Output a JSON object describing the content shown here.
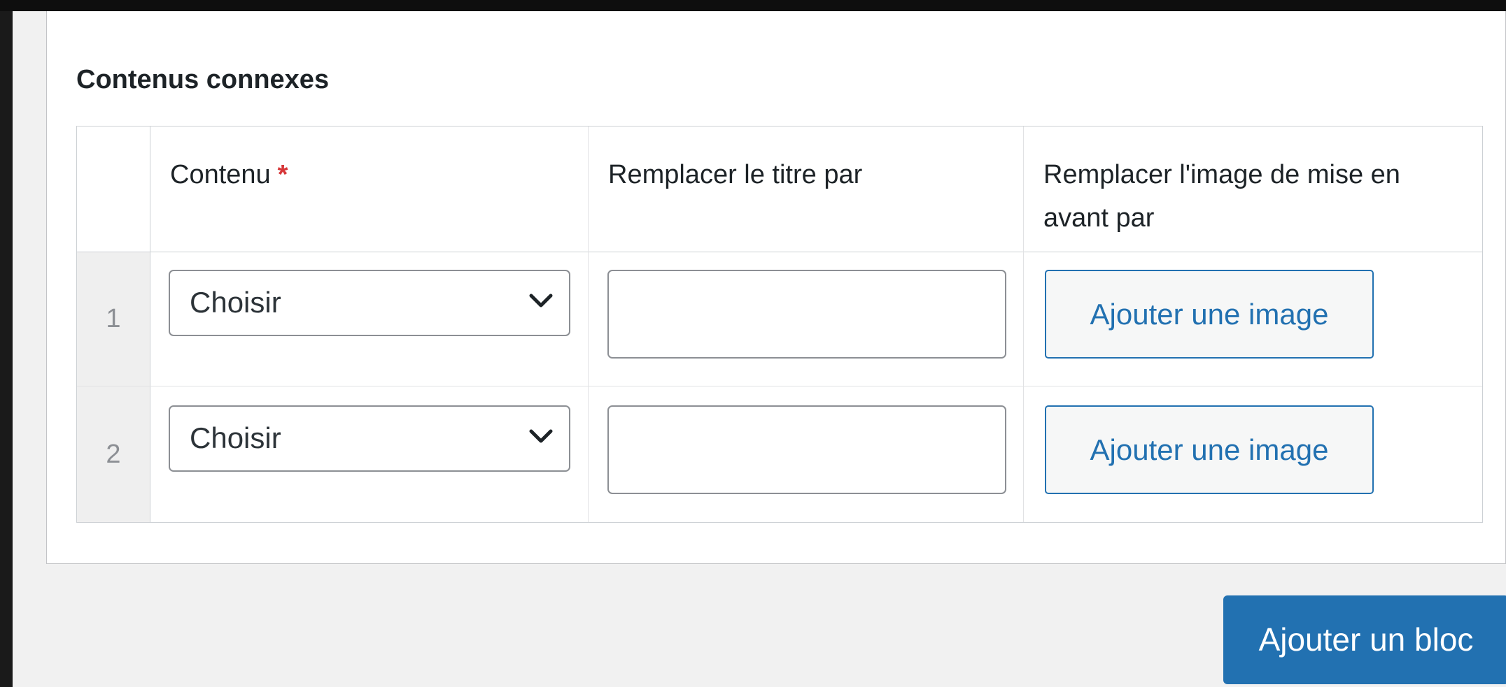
{
  "section": {
    "title": "Contenus connexes"
  },
  "table": {
    "headers": {
      "content": "Contenu",
      "required_marker": "*",
      "replace_title": "Remplacer le titre par",
      "replace_image": "Remplacer l'image de mise en avant par"
    },
    "rows": [
      {
        "index": "1",
        "select_value": "Choisir",
        "title_value": "",
        "image_button": "Ajouter une image"
      },
      {
        "index": "2",
        "select_value": "Choisir",
        "title_value": "",
        "image_button": "Ajouter une image"
      }
    ]
  },
  "footer": {
    "add_block_label": "Ajouter un bloc"
  },
  "icons": {
    "select_arrow": "chevron-down-icon"
  },
  "colors": {
    "primary": "#2271b1",
    "required": "#d63638",
    "text": "#1d2327",
    "border": "#8c8f94"
  }
}
